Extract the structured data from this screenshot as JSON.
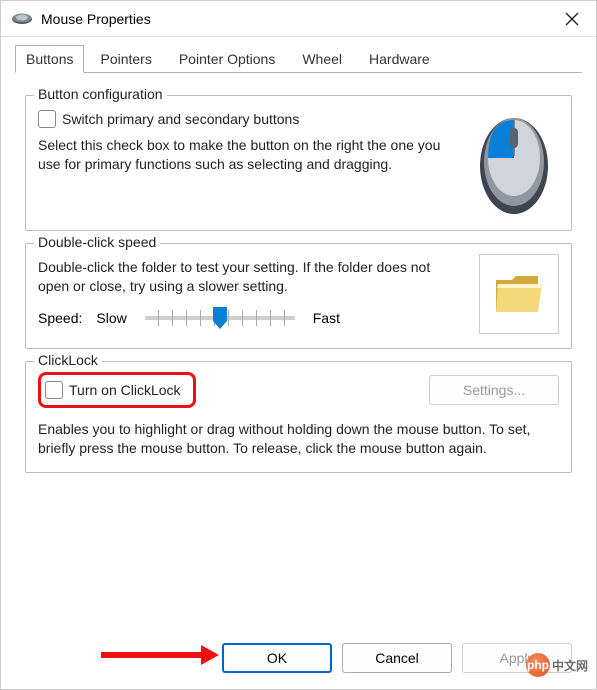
{
  "window": {
    "title": "Mouse Properties"
  },
  "tabs": {
    "items": [
      "Buttons",
      "Pointers",
      "Pointer Options",
      "Wheel",
      "Hardware"
    ],
    "active_index": 0
  },
  "button_config": {
    "legend": "Button configuration",
    "checkbox_label": "Switch primary and secondary buttons",
    "checked": false,
    "description": "Select this check box to make the button on the right the one you use for primary functions such as selecting and dragging."
  },
  "double_click": {
    "legend": "Double-click speed",
    "description": "Double-click the folder to test your setting. If the folder does not open or close, try using a slower setting.",
    "speed_label": "Speed:",
    "slow_label": "Slow",
    "fast_label": "Fast"
  },
  "clicklock": {
    "legend": "ClickLock",
    "checkbox_label": "Turn on ClickLock",
    "checked": false,
    "settings_label": "Settings...",
    "settings_enabled": false,
    "description": "Enables you to highlight or drag without holding down the mouse button. To set, briefly press the mouse button. To release, click the mouse button again."
  },
  "buttons": {
    "ok": "OK",
    "cancel": "Cancel",
    "apply": "Apply"
  },
  "watermark": {
    "badge": "php",
    "text": "中文网"
  }
}
